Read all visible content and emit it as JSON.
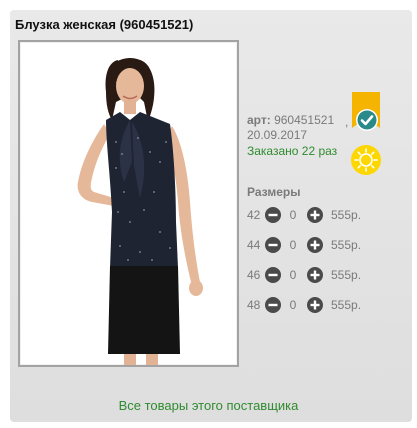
{
  "product": {
    "title": "Блузка женская (960451521)",
    "art_label": "арт:",
    "art_value": "960451521",
    "art_comma": ",",
    "date": "20.09.2017",
    "ordered": "Заказано 22 раз"
  },
  "sizes": {
    "heading": "Размеры",
    "rows": [
      {
        "size": "42",
        "qty": "0",
        "price": "555р."
      },
      {
        "size": "44",
        "qty": "0",
        "price": "555р."
      },
      {
        "size": "46",
        "qty": "0",
        "price": "555р."
      },
      {
        "size": "48",
        "qty": "0",
        "price": "555р."
      }
    ]
  },
  "footer": {
    "supplier_link": "Все товары этого поставщика"
  },
  "icons": {
    "bookmark": "bookmark-icon",
    "check": "check-badge-icon",
    "sun": "sun-icon",
    "minus": "minus-circle-icon",
    "plus": "plus-circle-icon"
  },
  "colors": {
    "accent_green": "#2e8b2e",
    "bookmark_yellow": "#f4b400",
    "check_teal": "#2a8a8a",
    "sun_yellow": "#ffd700"
  }
}
